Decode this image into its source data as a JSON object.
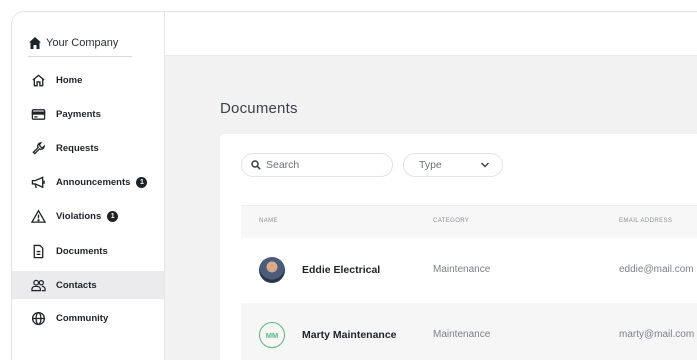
{
  "brand": {
    "name": "Your Company"
  },
  "nav": {
    "items": [
      {
        "label": "Home",
        "icon": "home-icon"
      },
      {
        "label": "Payments",
        "icon": "credit-card-icon"
      },
      {
        "label": "Requests",
        "icon": "wrench-icon"
      },
      {
        "label": "Announcements",
        "icon": "megaphone-icon",
        "badge": "1"
      },
      {
        "label": "Violations",
        "icon": "warning-icon",
        "badge": "1"
      },
      {
        "label": "Documents",
        "icon": "document-icon"
      },
      {
        "label": "Contacts",
        "icon": "contacts-icon",
        "active": true
      },
      {
        "label": "Community",
        "icon": "globe-icon"
      }
    ]
  },
  "page": {
    "title": "Documents"
  },
  "filters": {
    "search_placeholder": "Search",
    "type_label": "Type"
  },
  "table": {
    "columns": [
      "NAME",
      "CATEGORY",
      "EMAIL ADDRESS"
    ],
    "rows": [
      {
        "name": "Eddie Electrical",
        "category": "Maintenance",
        "email": "eddie@mail.com",
        "avatar": "photo"
      },
      {
        "name": "Marty Maintenance",
        "category": "Maintenance",
        "email": "marty@mail.com",
        "avatar": "MM"
      }
    ]
  },
  "colors": {
    "accent_green": "#59b87a",
    "active_bg": "#ebebed",
    "text_dark": "#1f2328"
  }
}
